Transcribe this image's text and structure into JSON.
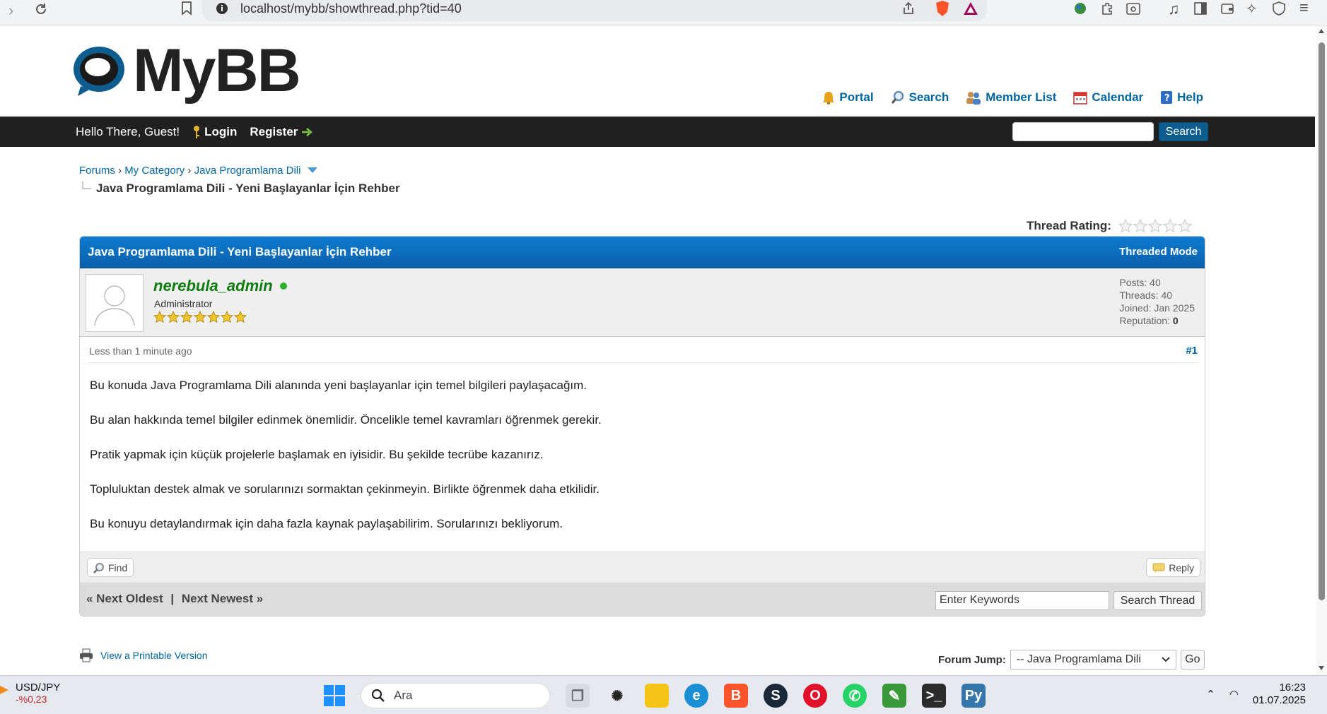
{
  "browser": {
    "url": "localhost/mybb/showthread.php?tid=40"
  },
  "header": {
    "logo_text": "MyBB",
    "menu": [
      {
        "label": "Portal",
        "icon": "bell-icon"
      },
      {
        "label": "Search",
        "icon": "magnifier-icon"
      },
      {
        "label": "Member List",
        "icon": "members-icon"
      },
      {
        "label": "Calendar",
        "icon": "calendar-icon"
      },
      {
        "label": "Help",
        "icon": "help-book-icon"
      }
    ]
  },
  "panel": {
    "welcome": "Hello There, Guest!",
    "login": "Login",
    "register": "Register",
    "search_button": "Search"
  },
  "breadcrumb": {
    "items": [
      "Forums",
      "My Category",
      "Java Programlama Dili"
    ],
    "separator": "›",
    "current": "Java Programlama Dili - Yeni Başlayanlar İçin Rehber"
  },
  "rating": {
    "label": "Thread Rating:",
    "stars": 0,
    "max": 5
  },
  "thread": {
    "title": "Java Programlama Dili - Yeni Başlayanlar İçin Rehber",
    "mode_link": "Threaded Mode"
  },
  "post": {
    "username": "nerebula_admin",
    "user_title": "Administrator",
    "user_stars": 7,
    "stats": {
      "posts": "Posts: 40",
      "threads": "Threads: 40",
      "joined": "Joined: Jan 2025",
      "reputation_label": "Reputation:",
      "reputation_value": "0"
    },
    "date": "Less than 1 minute ago",
    "number": "#1",
    "paragraphs": [
      "Bu konuda Java Programlama Dili alanında yeni başlayanlar için temel bilgileri paylaşacağım.",
      "Bu alan hakkında temel bilgiler edinmek önemlidir. Öncelikle temel kavramları öğrenmek gerekir.",
      "Pratik yapmak için küçük projelerle başlamak en iyisidir. Bu şekilde tecrübe kazanırız.",
      "Topluluktan destek almak ve sorularınızı sormaktan çekinmeyin. Birlikte öğrenmek daha etkilidir.",
      "Bu konuyu detaylandırmak için daha fazla kaynak paylaşabilirim. Sorularınızı bekliyorum."
    ],
    "find_button": "Find",
    "reply_button": "Reply"
  },
  "thread_nav": {
    "prev": "« Next Oldest",
    "separator": "|",
    "next": "Next Newest »",
    "keywords_placeholder": "Enter Keywords",
    "search_thread_button": "Search Thread"
  },
  "footer": {
    "printable": "View a Printable Version",
    "forum_jump_label": "Forum Jump:",
    "forum_jump_selected": "-- Java Programlama Dili",
    "go_button": "Go"
  },
  "taskbar": {
    "ticker_symbol": "USD/JPY",
    "ticker_value": "-%0,23",
    "search_placeholder": "Ara",
    "time": "16:23",
    "date": "01.07.2025"
  },
  "colors": {
    "link": "#0066a2",
    "panel": "#202020",
    "thead": "#0a60ab",
    "username": "#0f7c10"
  }
}
